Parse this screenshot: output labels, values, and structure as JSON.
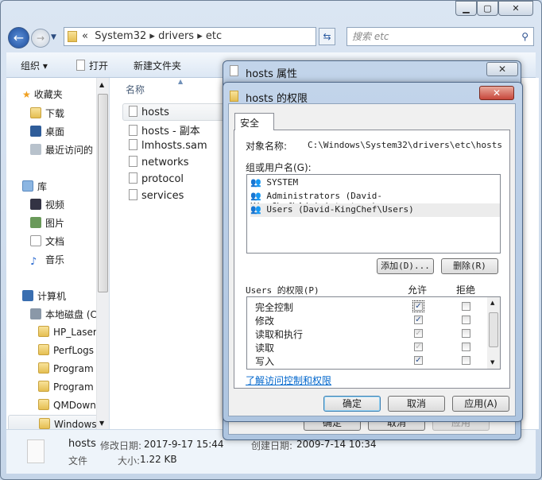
{
  "window": {
    "caption_buttons": [
      "minimize",
      "maximize",
      "close"
    ]
  },
  "address": {
    "path": [
      "System32",
      "drivers",
      "etc"
    ],
    "prefix": "«",
    "search_placeholder": "搜索 etc"
  },
  "toolbar": {
    "organize": "组织 ▾",
    "open": "打开",
    "new_folder": "新建文件夹"
  },
  "nav": {
    "favorites": "收藏夹",
    "fav_items": [
      "下载",
      "桌面",
      "最近访问的"
    ],
    "libraries": "库",
    "lib_items": [
      "视频",
      "图片",
      "文档",
      "音乐"
    ],
    "computer": "计算机",
    "drive": "本地磁盘 (C",
    "folders": [
      "HP_Laser",
      "PerfLogs",
      "Program",
      "Program",
      "QMDown",
      "Windows"
    ]
  },
  "files": {
    "column": "名称",
    "items": [
      "hosts",
      "hosts - 副本",
      "lmhosts.sam",
      "networks",
      "protocol",
      "services"
    ],
    "selected": 0
  },
  "details": {
    "name": "hosts",
    "type": "文件",
    "modified_label": "修改日期:",
    "modified": "2017-9-17 15:44",
    "size_label": "大小:",
    "size": "1.22 KB",
    "created_label": "创建日期:",
    "created": "2009-7-14 10:34"
  },
  "props_dialog": {
    "title": "hosts 属性",
    "buttons": [
      "确定",
      "取消",
      "应用"
    ]
  },
  "perm_dialog": {
    "title": "hosts 的权限",
    "tab": "安全",
    "object_label": "对象名称:",
    "object_value": "C:\\Windows\\System32\\drivers\\etc\\hosts",
    "group_label": "组或用户名(G):",
    "users": [
      "SYSTEM",
      "Administrators (David-KingChef\\Administrators)",
      "Users (David-KingChef\\Users)"
    ],
    "selected_user": 2,
    "add": "添加(D)...",
    "remove": "删除(R)",
    "perm_label": "Users 的权限(P)",
    "allow": "允许",
    "deny": "拒绝",
    "permissions": [
      {
        "name": "完全控制",
        "allow": true,
        "allow_inherited": false,
        "deny": false
      },
      {
        "name": "修改",
        "allow": true,
        "allow_inherited": false,
        "deny": false
      },
      {
        "name": "读取和执行",
        "allow": true,
        "allow_inherited": true,
        "deny": false
      },
      {
        "name": "读取",
        "allow": true,
        "allow_inherited": true,
        "deny": false
      },
      {
        "name": "写入",
        "allow": true,
        "allow_inherited": false,
        "deny": false
      }
    ],
    "link": "了解访问控制和权限",
    "ok": "确定",
    "cancel": "取消",
    "apply": "应用(A)"
  }
}
